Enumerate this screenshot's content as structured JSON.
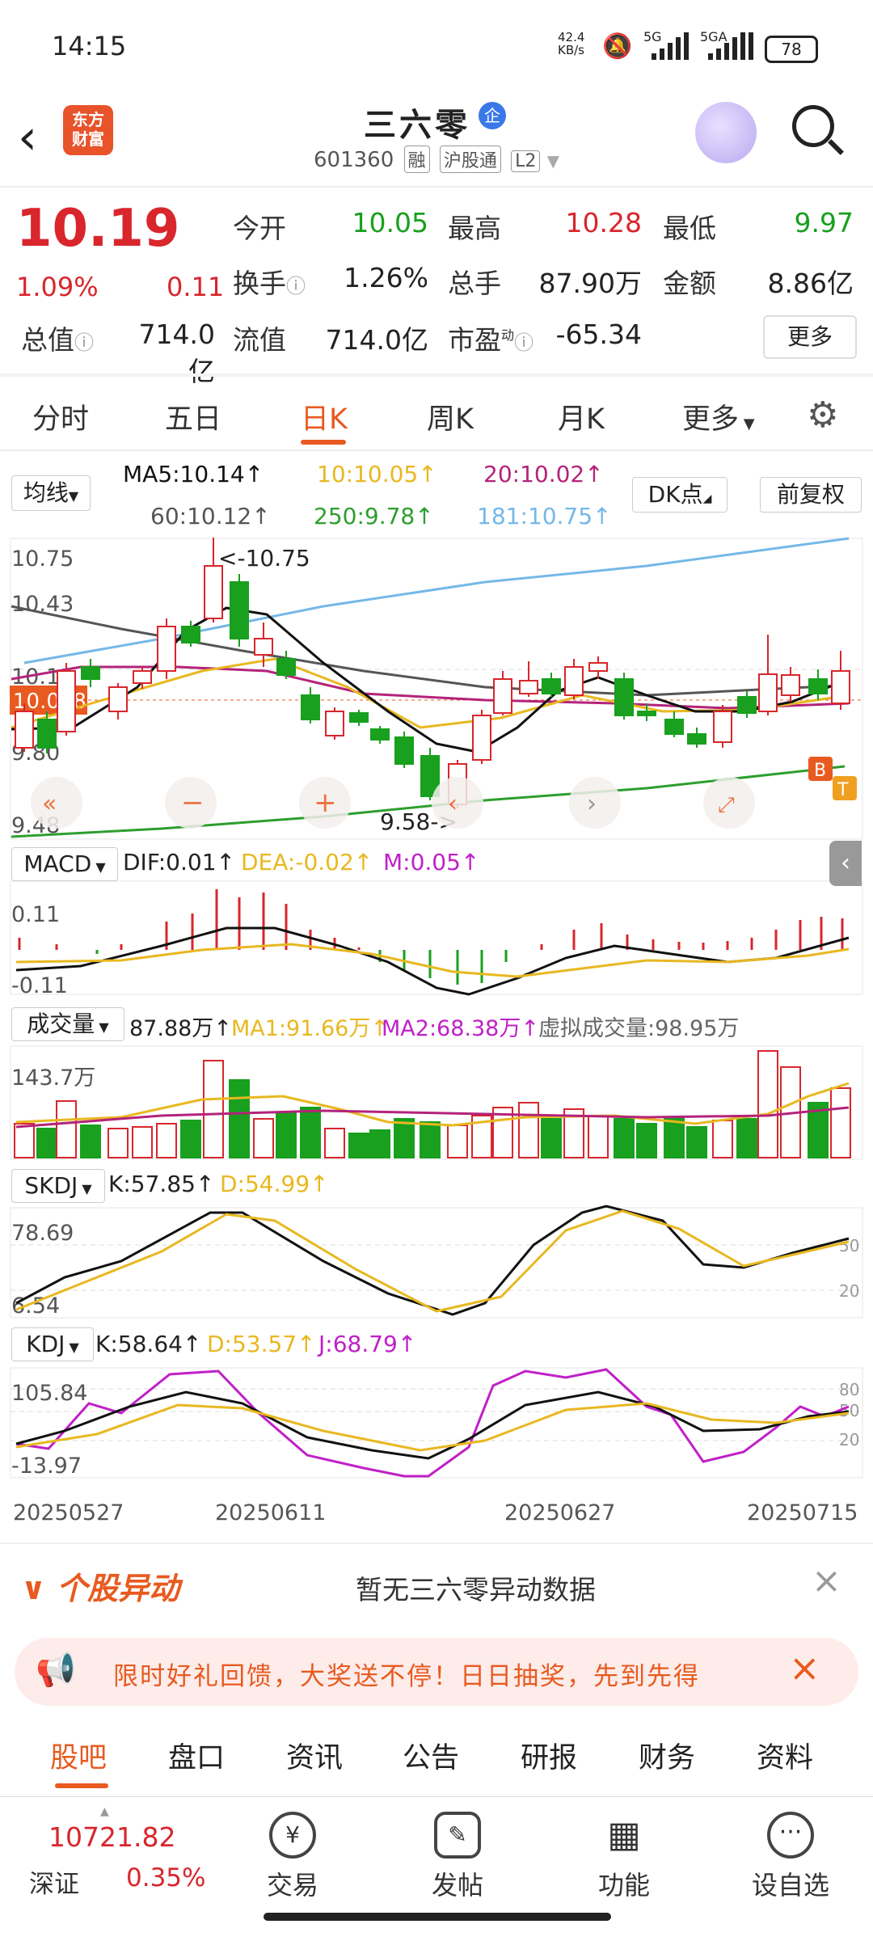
{
  "status": {
    "time": "14:15",
    "net_speed": "42.4\nKB/s",
    "signal1": "5G",
    "signal2": "5GA",
    "battery": "78"
  },
  "header": {
    "logo_text": "东方\n财富",
    "stock_name": "三六零",
    "badge": "企",
    "code": "601360",
    "tags": [
      "融",
      "沪股通",
      "L2"
    ]
  },
  "quote": {
    "price": "10.19",
    "pct": "1.09%",
    "change": "0.11",
    "open_label": "今开",
    "open": "10.05",
    "high_label": "最高",
    "high": "10.28",
    "low_label": "最低",
    "low": "9.97",
    "turnover_label": "换手",
    "turnover": "1.26%",
    "volume_label": "总手",
    "volume": "87.90万",
    "amount_label": "金额",
    "amount": "8.86亿",
    "mktcap_label": "总值",
    "mktcap": "714.0亿",
    "float_label": "流值",
    "float": "714.0亿",
    "pe_label": "市盈",
    "pe_sup": "动",
    "pe": "-65.34",
    "more": "更多"
  },
  "tabs": [
    "分时",
    "五日",
    "日K",
    "周K",
    "月K",
    "更多"
  ],
  "active_tab": 2,
  "ma": {
    "selector": "均线",
    "dk": "DK点",
    "fq": "前复权",
    "ma5": "MA5:10.14",
    "ma10": "10:10.05",
    "ma20": "20:10.02",
    "ma60": "60:10.12",
    "ma250": "250:9.78",
    "ma181": "181:10.75"
  },
  "kline": {
    "ticks": [
      "10.75",
      "10.43",
      "10.11",
      "9.80",
      "9.48"
    ],
    "current": "10.068",
    "max_label": "<-10.75",
    "min_label": "9.58->",
    "b_marker": "B",
    "t_marker": "T"
  },
  "macd": {
    "selector": "MACD",
    "dif": "DIF:0.01",
    "dea": "DEA:-0.02",
    "m": "M:0.05",
    "top": "0.11",
    "bottom": "-0.11"
  },
  "vol": {
    "selector": "成交量",
    "v": "87.88万",
    "ma1": "MA1:91.66万",
    "ma2": "MA2:68.38万",
    "virtual": "虚拟成交量:98.95万",
    "top": "143.7万"
  },
  "skdj": {
    "selector": "SKDJ",
    "k": "K:57.85",
    "d": "D:54.99",
    "top": "78.69",
    "bottom": "6.54",
    "r50": "50",
    "r20": "20"
  },
  "kdj": {
    "selector": "KDJ",
    "k": "K:58.64",
    "d": "D:53.57",
    "j": "J:68.79",
    "top": "105.84",
    "bottom": "-13.97",
    "r80": "80",
    "r50": "50",
    "r20": "20"
  },
  "dates": [
    "20250527",
    "20250611",
    "20250627",
    "20250715"
  ],
  "alert": {
    "title": "个股异动",
    "text": "暂无三六零异动数据"
  },
  "promo": {
    "text": "限时好礼回馈，大奖送不停！日日抽奖，先到先得"
  },
  "bottom_tabs": [
    "股吧",
    "盘口",
    "资讯",
    "公告",
    "研报",
    "财务",
    "资料"
  ],
  "index": {
    "value": "10721.82",
    "name": "深证",
    "pct": "0.35%"
  },
  "nav": [
    "交易",
    "发帖",
    "功能",
    "设自选"
  ],
  "colors": {
    "up": "#d8262c",
    "down": "#18a01e",
    "accent": "#e85a1f",
    "ma5": "#111111",
    "ma10": "#e8b820",
    "ma20": "#b4237a",
    "ma60": "#555555",
    "ma250": "#2e9e2e",
    "ma181": "#74b8e8"
  }
}
